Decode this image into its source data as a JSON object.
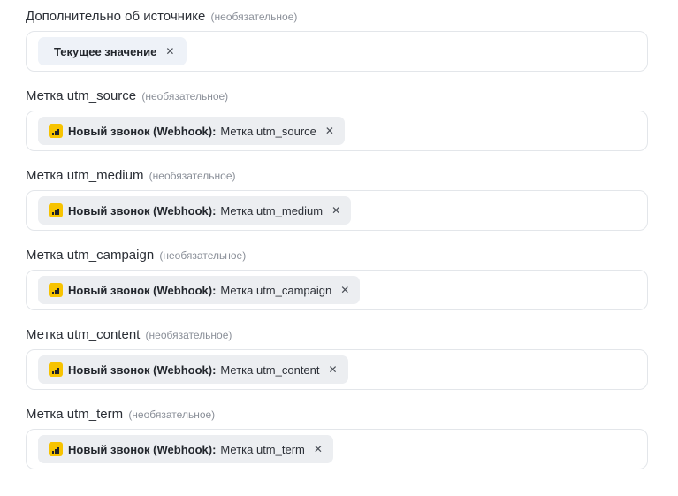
{
  "optional_note": "(необязательное)",
  "fields": [
    {
      "label": "Дополнительно об источнике",
      "chip": {
        "kind": "plain",
        "title": "Текущее значение",
        "value": ""
      }
    },
    {
      "label": "Метка utm_source",
      "chip": {
        "kind": "source",
        "icon": "bar-chart-icon",
        "title": "Новый звонок (Webhook):",
        "value": "Метка utm_source"
      }
    },
    {
      "label": "Метка utm_medium",
      "chip": {
        "kind": "source",
        "icon": "bar-chart-icon",
        "title": "Новый звонок (Webhook):",
        "value": "Метка utm_medium"
      }
    },
    {
      "label": "Метка utm_campaign",
      "chip": {
        "kind": "source",
        "icon": "bar-chart-icon",
        "title": "Новый звонок (Webhook):",
        "value": "Метка utm_campaign"
      }
    },
    {
      "label": "Метка utm_content",
      "chip": {
        "kind": "source",
        "icon": "bar-chart-icon",
        "title": "Новый звонок (Webhook):",
        "value": "Метка utm_content"
      }
    },
    {
      "label": "Метка utm_term",
      "chip": {
        "kind": "source",
        "icon": "bar-chart-icon",
        "title": "Новый звонок (Webhook):",
        "value": "Метка utm_term"
      }
    }
  ],
  "remove_glyph": "✕",
  "colors": {
    "app_icon": "#f7c300",
    "chip_plain_bg": "#eef2f8",
    "chip_source_bg": "#eceef1",
    "input_border": "#e3e6ea",
    "optional_text": "#8a8f98"
  }
}
